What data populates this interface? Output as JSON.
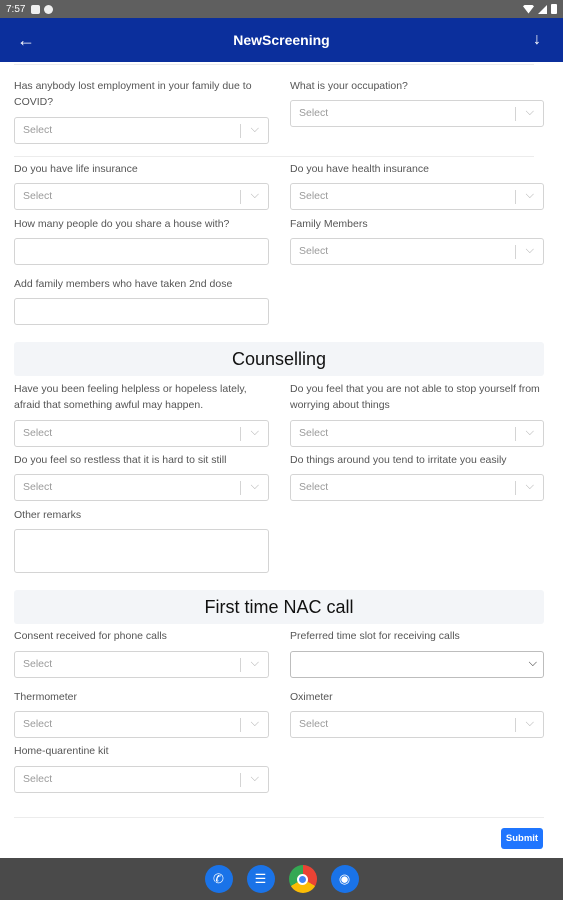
{
  "status_bar": {
    "time": "7:57"
  },
  "app_bar": {
    "title": "NewScreening",
    "back_icon": "←",
    "download_icon": "↓"
  },
  "placeholder": "Select",
  "chevron": "⌵",
  "fields": {
    "lost_employment": "Has anybody lost employment in your family due to COVID?",
    "occupation": "What is your occupation?",
    "life_insurance": "Do you have life insurance",
    "health_insurance": "Do you have health insurance",
    "share_house": "How many people do you share a house with?",
    "family_members": "Family Members",
    "second_dose": "Add family members who have taken 2nd dose",
    "helpless": "Have you been feeling helpless or hopeless lately, afraid that something awful may happen.",
    "worrying": "Do you feel that you are not able to stop yourself from worrying about things",
    "restless": "Do you feel so restless that it is hard to sit still",
    "irritate": "Do things around you tend to irritate you easily",
    "other_remarks": "Other remarks",
    "consent": "Consent received for phone calls",
    "time_slot": "Preferred time slot for receiving calls",
    "thermometer": "Thermometer",
    "oximeter": "Oximeter",
    "home_kit": "Home-quarentine kit"
  },
  "sections": {
    "counselling": "Counselling",
    "nac_call": "First time NAC call"
  },
  "submit_label": "Submit",
  "colors": {
    "app_bar": "#0b2f9c",
    "submit": "#1f75fe"
  }
}
